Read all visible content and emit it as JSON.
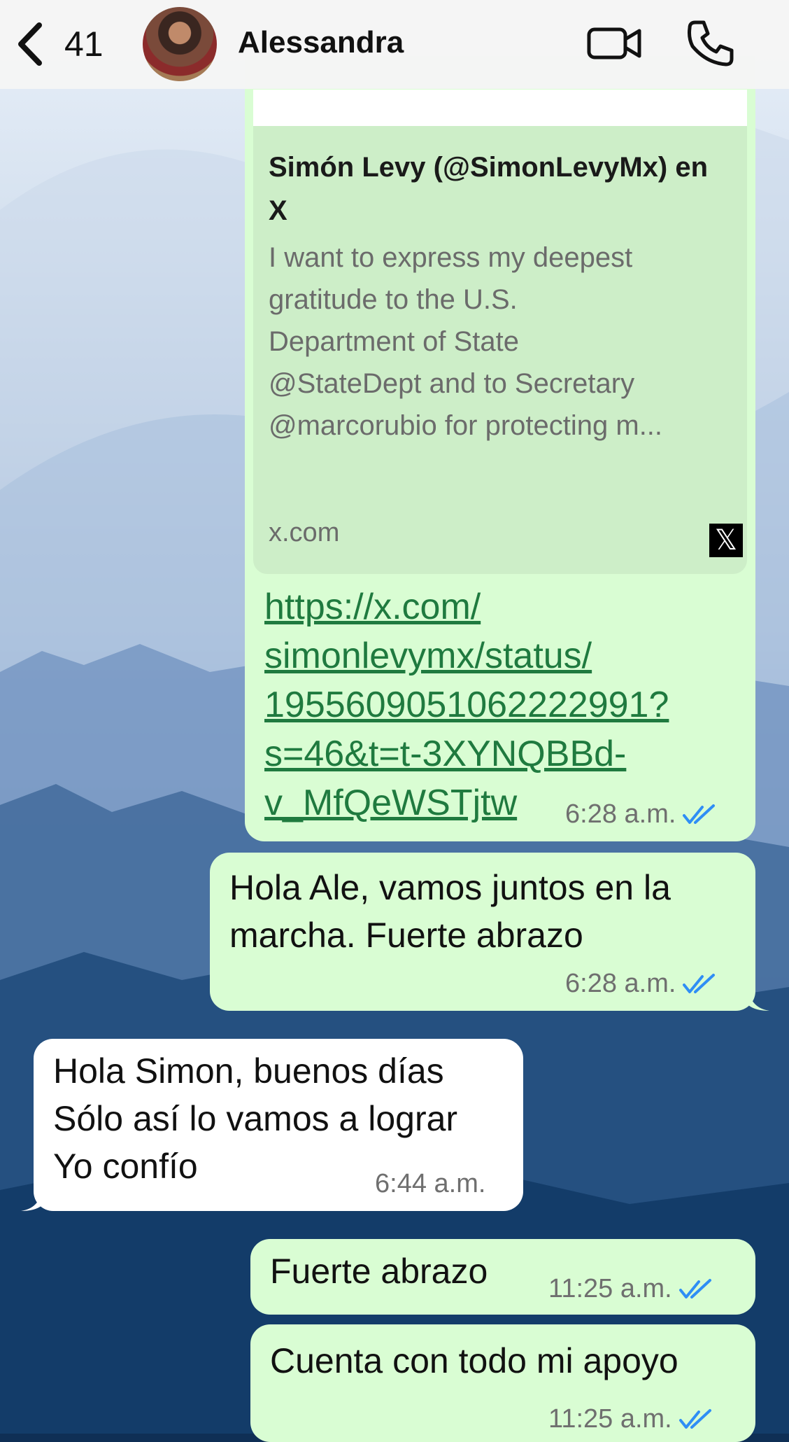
{
  "header": {
    "back_count": "41",
    "contact_name": "Alessandra",
    "icons": [
      "chevron-left-icon",
      "video-camera-icon",
      "phone-icon"
    ]
  },
  "messages": [
    {
      "direction": "outgoing",
      "preview": {
        "title": "Simón Levy (@SimonLevyMx) en X",
        "description_lines": [
          "I want to express my deepest",
          "gratitude to the U.S.",
          "Department of State",
          "@StateDept  and to Secretary",
          "@marcorubio for protecting m..."
        ],
        "domain": "x.com",
        "logo": "𝕏"
      },
      "link_lines": [
        "https://x.com/",
        "simonlevymx/status/",
        "1955609051062222991?",
        "s=46&t=t-3XYNQBBd-",
        "v_MfQeWSTjtw"
      ],
      "time": "6:28 a.m.",
      "read": true
    },
    {
      "direction": "outgoing",
      "lines": [
        "Hola Ale, vamos juntos en la",
        "marcha. Fuerte abrazo"
      ],
      "time": "6:28 a.m.",
      "read": true
    },
    {
      "direction": "incoming",
      "lines": [
        "Hola Simon, buenos días",
        "Sólo así lo vamos a lograr",
        "Yo confío"
      ],
      "time": "6:44 a.m."
    },
    {
      "direction": "outgoing",
      "lines": [
        "Fuerte abrazo"
      ],
      "time": "11:25 a.m.",
      "read": true
    },
    {
      "direction": "outgoing",
      "lines": [
        "Cuenta con todo mi apoyo"
      ],
      "time": "11:25 a.m.",
      "read": true
    }
  ],
  "colors": {
    "outgoing_bubble": "#d9fdd3",
    "incoming_bubble": "#ffffff",
    "link": "#1f7a3f",
    "read_ticks": "#2f8ef5"
  }
}
